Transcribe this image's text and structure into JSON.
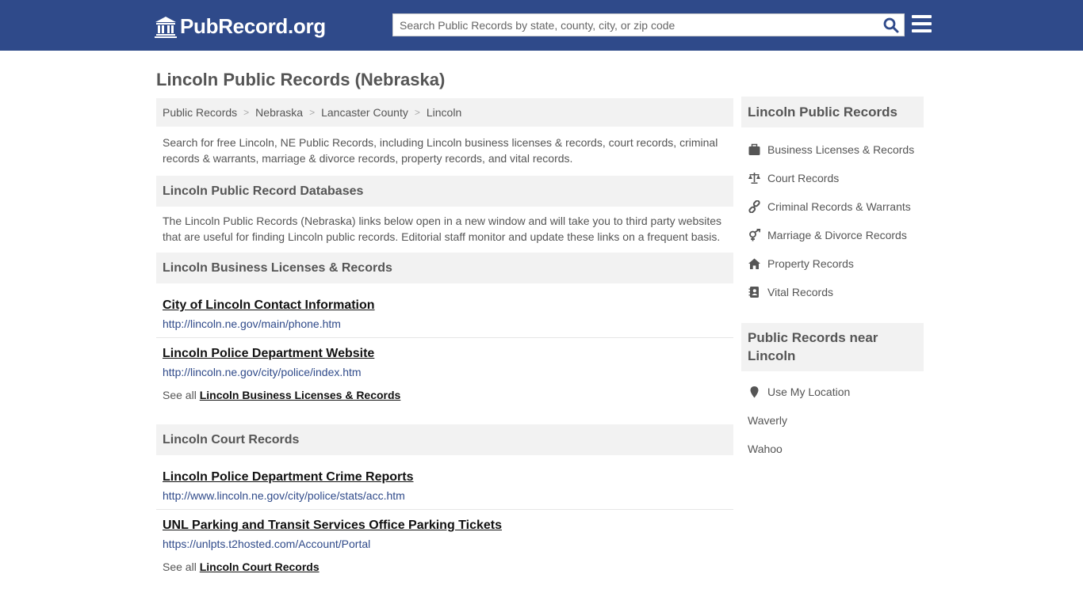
{
  "header": {
    "logo_text": "PubRecord.org",
    "search_placeholder": "Search Public Records by state, county, city, or zip code",
    "search_value": ""
  },
  "page": {
    "title": "Lincoln Public Records (Nebraska)"
  },
  "breadcrumb": [
    "Public Records",
    "Nebraska",
    "Lancaster County",
    "Lincoln"
  ],
  "intro": "Search for free Lincoln, NE Public Records, including Lincoln business licenses & records, court records, criminal records & warrants, marriage & divorce records, property records, and vital records.",
  "databases": {
    "heading": "Lincoln Public Record Databases",
    "text": "The Lincoln Public Records (Nebraska) links below open in a new window and will take you to third party websites that are useful for finding Lincoln public records. Editorial staff monitor and update these links on a frequent basis."
  },
  "sections": [
    {
      "heading": "Lincoln Business Licenses & Records",
      "records": [
        {
          "title": "City of Lincoln Contact Information",
          "url": "http://lincoln.ne.gov/main/phone.htm"
        },
        {
          "title": "Lincoln Police Department Website",
          "url": "http://lincoln.ne.gov/city/police/index.htm"
        }
      ],
      "see_all_prefix": "See all",
      "see_all_link": "Lincoln Business Licenses & Records"
    },
    {
      "heading": "Lincoln Court Records",
      "records": [
        {
          "title": "Lincoln Police Department Crime Reports",
          "url": "http://www.lincoln.ne.gov/city/police/stats/acc.htm"
        },
        {
          "title": "UNL Parking and Transit Services Office Parking Tickets",
          "url": "https://unlpts.t2hosted.com/Account/Portal"
        }
      ],
      "see_all_prefix": "See all",
      "see_all_link": "Lincoln Court Records"
    }
  ],
  "sidebar": {
    "records_heading": "Lincoln Public Records",
    "records_links": [
      {
        "label": "Business Licenses & Records",
        "icon": "briefcase-icon"
      },
      {
        "label": "Court Records",
        "icon": "balance-scale-icon"
      },
      {
        "label": "Criminal Records & Warrants",
        "icon": "link-icon"
      },
      {
        "label": "Marriage & Divorce Records",
        "icon": "venus-mars-icon"
      },
      {
        "label": "Property Records",
        "icon": "home-icon"
      },
      {
        "label": "Vital Records",
        "icon": "address-book-icon"
      }
    ],
    "nearby_heading": "Public Records near Lincoln",
    "use_location": "Use My Location",
    "nearby_places": [
      "Waverly",
      "Wahoo"
    ]
  }
}
